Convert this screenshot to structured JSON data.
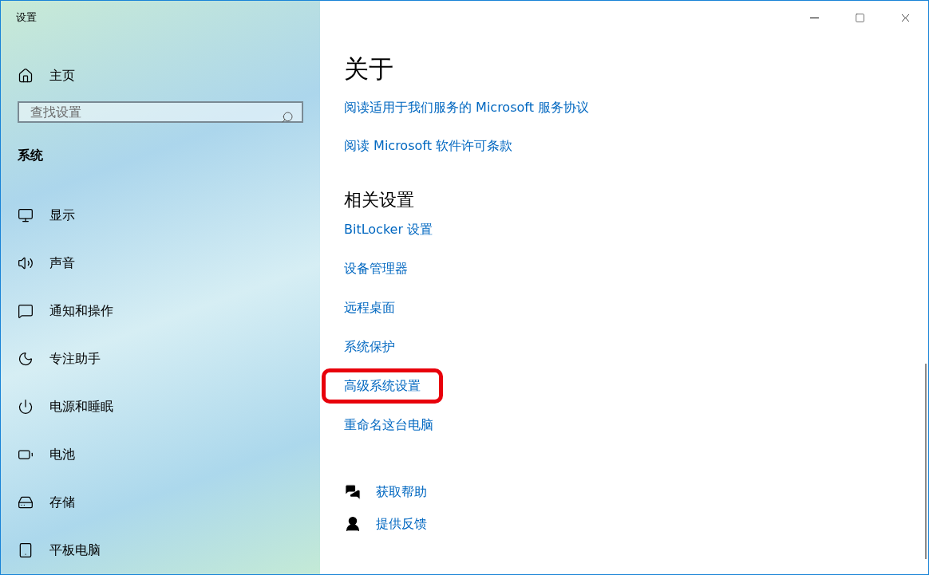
{
  "window": {
    "title": "设置"
  },
  "sidebar": {
    "home": "主页",
    "search": {
      "placeholder": "查找设置"
    },
    "section": "系统",
    "items": [
      {
        "kind": "display",
        "label": "显示"
      },
      {
        "kind": "sound",
        "label": "声音"
      },
      {
        "kind": "notifications",
        "label": "通知和操作"
      },
      {
        "kind": "focus",
        "label": "专注助手"
      },
      {
        "kind": "power",
        "label": "电源和睡眠"
      },
      {
        "kind": "battery",
        "label": "电池"
      },
      {
        "kind": "storage",
        "label": "存储"
      },
      {
        "kind": "tablet",
        "label": "平板电脑"
      }
    ]
  },
  "content": {
    "title": "关于",
    "links": [
      {
        "label": "阅读适用于我们服务的 Microsoft 服务协议"
      },
      {
        "label": "阅读 Microsoft 软件许可条款"
      }
    ],
    "related": {
      "heading": "相关设置",
      "links": [
        {
          "label": "BitLocker 设置",
          "highlighted": false
        },
        {
          "label": "设备管理器",
          "highlighted": false
        },
        {
          "label": "远程桌面",
          "highlighted": false
        },
        {
          "label": "系统保护",
          "highlighted": false
        },
        {
          "label": "高级系统设置",
          "highlighted": true
        },
        {
          "label": "重命名这台电脑",
          "highlighted": false
        }
      ]
    },
    "support": [
      {
        "kind": "help",
        "label": "获取帮助"
      },
      {
        "kind": "feedback",
        "label": "提供反馈"
      }
    ]
  }
}
